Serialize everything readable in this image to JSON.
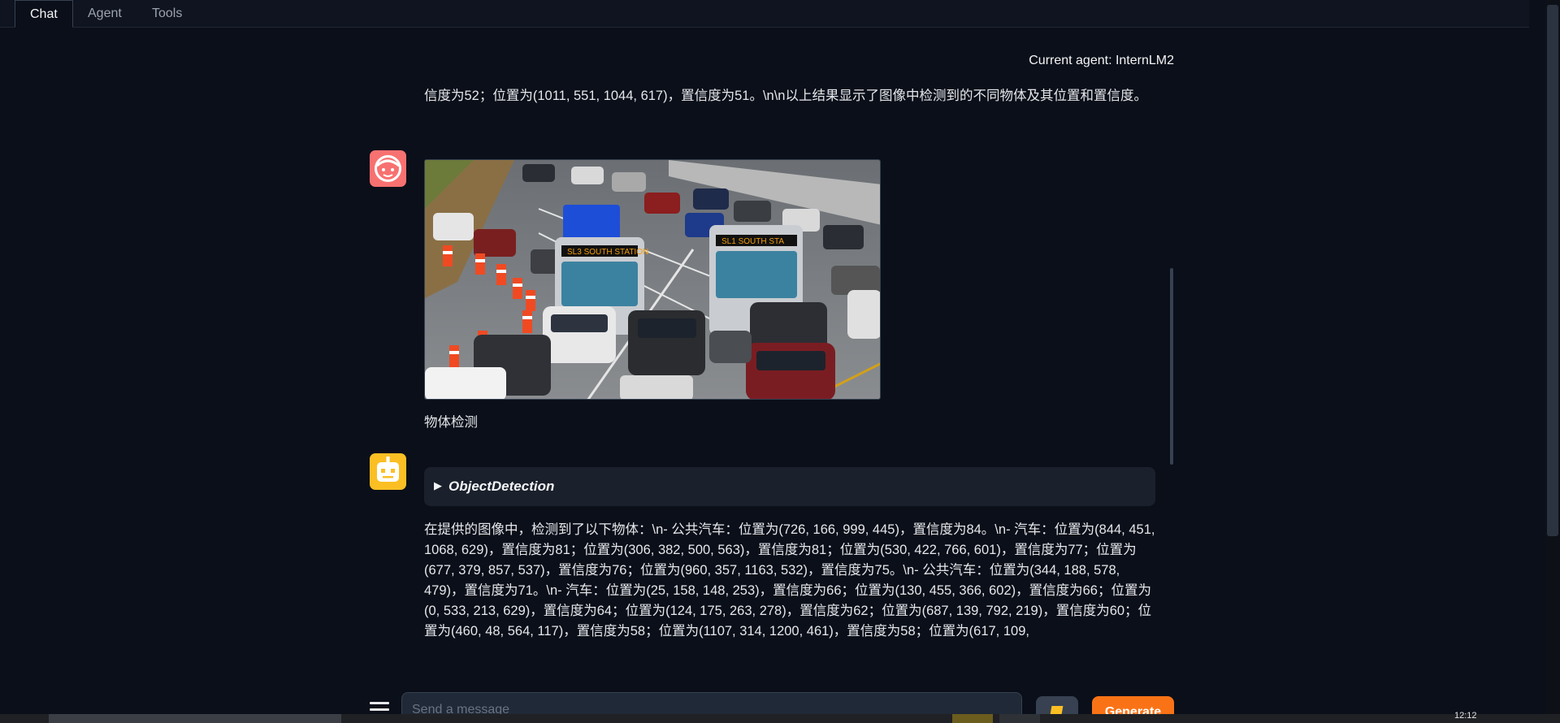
{
  "tabs": [
    "Chat",
    "Agent",
    "Tools"
  ],
  "current_agent": "Current agent: InternLM2",
  "messages": {
    "prev_tail": "信度为52；位置为(1011, 551, 1044, 617)，置信度为51。\\n\\n以上结果显示了图像中检测到的不同物体及其位置和置信度。",
    "user_caption": "物体检测",
    "tool_title": "ObjectDetection",
    "bot_reply": "在提供的图像中，检测到了以下物体：\\n- 公共汽车：位置为(726, 166, 999, 445)，置信度为84。\\n- 汽车：位置为(844, 451, 1068, 629)，置信度为81；位置为(306, 382, 500, 563)，置信度为81；位置为(530, 422, 766, 601)，置信度为77；位置为(677, 379, 857, 537)，置信度为76；位置为(960, 357, 1163, 532)，置信度为75。\\n- 公共汽车：位置为(344, 188, 578, 479)，置信度为71。\\n- 汽车：位置为(25, 158, 148, 253)，置信度为66；位置为(130, 455, 366, 602)，置信度为66；位置为(0, 533, 213, 629)，置信度为64；位置为(124, 175, 263, 278)，置信度为62；位置为(687, 139, 792, 219)，置信度为60；位置为(460, 48, 564, 117)，置信度为58；位置为(1107, 314, 1200, 461)，置信度为58；位置为(617, 109,"
  },
  "image_labels": {
    "bus_left": "SL3 SOUTH STATION",
    "bus_right": "SL1 SOUTH STA"
  },
  "input": {
    "placeholder": "Send a message"
  },
  "buttons": {
    "generate": "Generate"
  },
  "taskbar": {
    "clock": "12:12"
  },
  "colors": {
    "accent": "#f97316",
    "user_avatar": "#f87171",
    "bot_avatar": "#fbbf24"
  }
}
